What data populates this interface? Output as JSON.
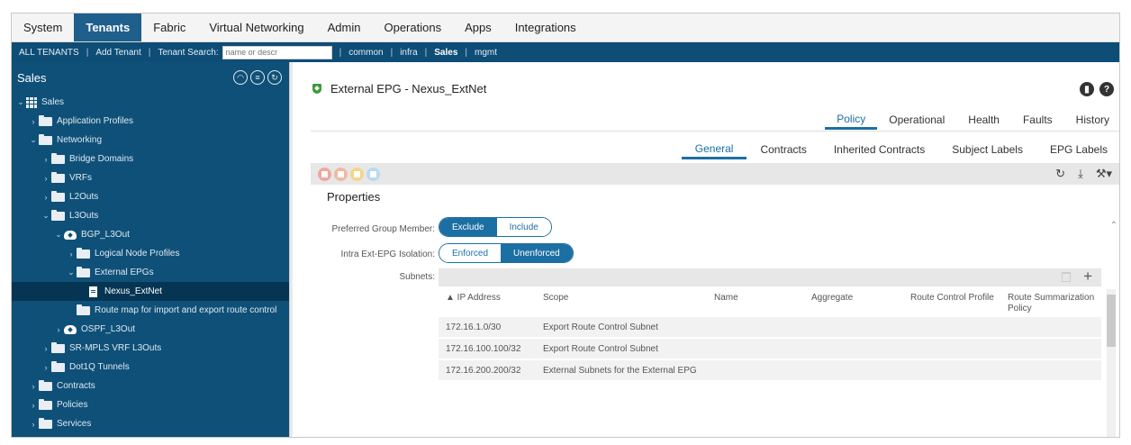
{
  "top_menu": [
    "System",
    "Tenants",
    "Fabric",
    "Virtual Networking",
    "Admin",
    "Operations",
    "Apps",
    "Integrations"
  ],
  "top_menu_active": "Tenants",
  "sub_bar": {
    "all_tenants": "ALL TENANTS",
    "add_tenant": "Add Tenant",
    "tenant_search_label": "Tenant Search:",
    "search_placeholder": "name or descr",
    "tenants": [
      "common",
      "infra",
      "Sales",
      "mgmt"
    ],
    "active_tenant": "Sales"
  },
  "left_nav": {
    "title": "Sales",
    "tree": [
      {
        "label": "Sales",
        "depth": 0,
        "icon": "grid",
        "caret": "open"
      },
      {
        "label": "Application Profiles",
        "depth": 1,
        "icon": "folder",
        "caret": "closed"
      },
      {
        "label": "Networking",
        "depth": 1,
        "icon": "folder",
        "caret": "open"
      },
      {
        "label": "Bridge Domains",
        "depth": 2,
        "icon": "folder",
        "caret": "closed"
      },
      {
        "label": "VRFs",
        "depth": 2,
        "icon": "folder",
        "caret": "closed"
      },
      {
        "label": "L2Outs",
        "depth": 2,
        "icon": "folder",
        "caret": "closed"
      },
      {
        "label": "L3Outs",
        "depth": 2,
        "icon": "folder",
        "caret": "open"
      },
      {
        "label": "BGP_L3Out",
        "depth": 3,
        "icon": "cloud",
        "caret": "open"
      },
      {
        "label": "Logical Node Profiles",
        "depth": 4,
        "icon": "folder",
        "caret": "closed"
      },
      {
        "label": "External EPGs",
        "depth": 4,
        "icon": "folder",
        "caret": "open"
      },
      {
        "label": "Nexus_ExtNet",
        "depth": 5,
        "icon": "doc",
        "caret": "none",
        "selected": true
      },
      {
        "label": "Route map for import and export route control",
        "depth": 4,
        "icon": "folder",
        "caret": "none"
      },
      {
        "label": "OSPF_L3Out",
        "depth": 3,
        "icon": "cloud",
        "caret": "closed"
      },
      {
        "label": "SR-MPLS VRF L3Outs",
        "depth": 2,
        "icon": "folder",
        "caret": "closed"
      },
      {
        "label": "Dot1Q Tunnels",
        "depth": 2,
        "icon": "folder",
        "caret": "closed"
      },
      {
        "label": "Contracts",
        "depth": 1,
        "icon": "folder",
        "caret": "closed"
      },
      {
        "label": "Policies",
        "depth": 1,
        "icon": "folder",
        "caret": "closed"
      },
      {
        "label": "Services",
        "depth": 1,
        "icon": "folder",
        "caret": "closed"
      }
    ]
  },
  "content": {
    "title": "External EPG - Nexus_ExtNet",
    "tabs_primary": [
      "Policy",
      "Operational",
      "Health",
      "Faults",
      "History"
    ],
    "tabs_primary_active": "Policy",
    "tabs_secondary": [
      "General",
      "Contracts",
      "Inherited Contracts",
      "Subject Labels",
      "EPG Labels"
    ],
    "tabs_secondary_active": "General",
    "properties_title": "Properties",
    "preferred_group": {
      "label": "Preferred Group Member:",
      "options": [
        "Exclude",
        "Include"
      ],
      "selected": "Exclude"
    },
    "isolation": {
      "label": "Intra Ext-EPG Isolation:",
      "options": [
        "Enforced",
        "Unenforced"
      ],
      "selected": "Unenforced"
    },
    "subnets_label": "Subnets:",
    "table": {
      "columns": [
        "▲ IP Address",
        "Scope",
        "Name",
        "Aggregate",
        "Route Control Profile",
        "Route Summarization Policy"
      ],
      "rows": [
        [
          "172.16.1.0/30",
          "Export Route Control Subnet",
          "",
          "",
          "",
          ""
        ],
        [
          "172.16.100.100/32",
          "Export Route Control Subnet",
          "",
          "",
          "",
          ""
        ],
        [
          "172.16.200.200/32",
          "External Subnets for the External EPG",
          "",
          "",
          "",
          ""
        ]
      ]
    }
  }
}
